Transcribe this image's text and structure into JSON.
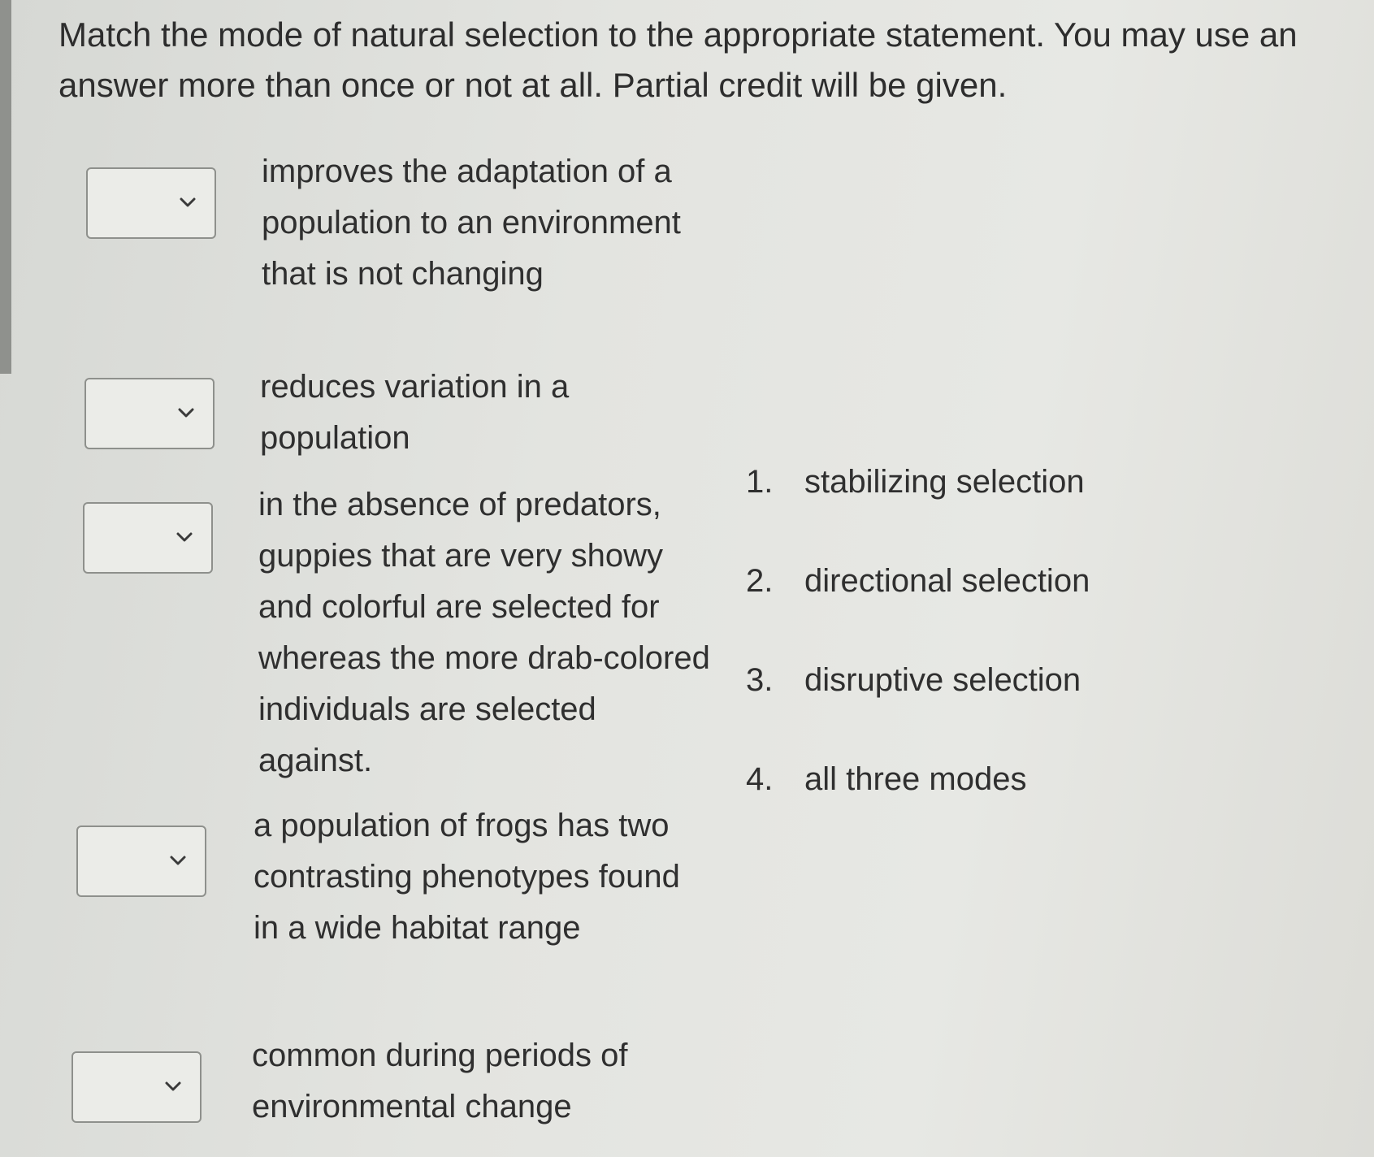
{
  "instructions": "Match the mode of natural selection to the appropriate statement.  You may use an answer more than once or not at all. Partial credit will be given.",
  "statements": [
    "improves the adaptation of a population to an environment that is not changing",
    "reduces variation in a population",
    "in the absence of predators, guppies that are very showy and colorful are selected for whereas the more drab-colored individuals are selected against.",
    "a population of frogs has two contrasting phenotypes found in a wide habitat range",
    "common during periods of environmental change"
  ],
  "dropdowns": [
    {
      "selected": ""
    },
    {
      "selected": ""
    },
    {
      "selected": ""
    },
    {
      "selected": ""
    },
    {
      "selected": ""
    }
  ],
  "options": [
    {
      "number": "1.",
      "label": "stabilizing selection"
    },
    {
      "number": "2.",
      "label": "directional selection"
    },
    {
      "number": "3.",
      "label": "disruptive selection"
    },
    {
      "number": "4.",
      "label": "all three modes"
    }
  ],
  "icons": {
    "dropdown": "chevron-down-icon"
  }
}
